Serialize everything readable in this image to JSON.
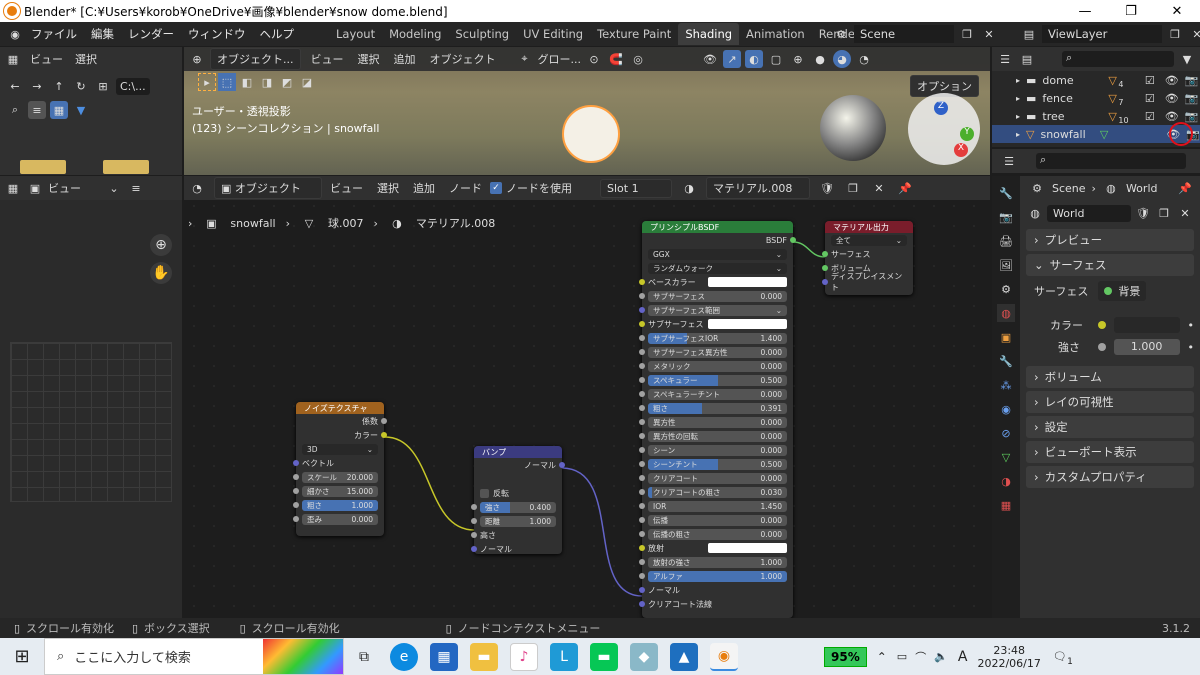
{
  "window": {
    "title": "Blender* [C:¥Users¥korob¥OneDrive¥画像¥blender¥snow dome.blend]"
  },
  "menu": [
    "ファイル",
    "編集",
    "レンダー",
    "ウィンドウ",
    "ヘルプ"
  ],
  "workspaces": [
    "Layout",
    "Modeling",
    "Sculpting",
    "UV Editing",
    "Texture Paint",
    "Shading",
    "Animation",
    "Rendering"
  ],
  "scene": {
    "name": "Scene",
    "view_layer": "ViewLayer"
  },
  "filebrowser": {
    "menu_view": "ビュー",
    "menu_select": "選択",
    "path": "C:\\..."
  },
  "viewport": {
    "mode": "オブジェクト...",
    "menu": [
      "ビュー",
      "選択",
      "追加",
      "オブジェクト"
    ],
    "transform": "グロー...",
    "options": "オプション",
    "title": "ユーザー・透視投影",
    "subtitle": "(123) シーンコレクション | snowfall"
  },
  "node_editor": {
    "header_view": "ビュー",
    "mode": "オブジェクト",
    "menu": [
      "ビュー",
      "選択",
      "追加",
      "ノード"
    ],
    "use_nodes": "ノードを使用",
    "slot": "Slot 1",
    "material": "マテリアル.008",
    "breadcrumb": [
      "snowfall",
      "球.007",
      "マテリアル.008"
    ]
  },
  "left_header": {
    "view": "ビュー"
  },
  "noise": {
    "title": "ノイズテクスチャ",
    "out_fac": "係数",
    "out_color": "カラー",
    "dim": "3D",
    "in_vector": "ベクトル",
    "fields": [
      {
        "label": "スケール",
        "value": "20.000",
        "fill": 0
      },
      {
        "label": "細かさ",
        "value": "15.000",
        "fill": 0
      },
      {
        "label": "粗さ",
        "value": "1.000",
        "fill": 1
      },
      {
        "label": "歪み",
        "value": "0.000",
        "fill": 0
      }
    ]
  },
  "bump": {
    "title": "バンプ",
    "out_normal": "ノーマル",
    "invert": "反転",
    "fields": [
      {
        "label": "強さ",
        "value": "0.400",
        "fill": 0.4
      },
      {
        "label": "距離",
        "value": "1.000",
        "fill": 0
      }
    ],
    "in_height": "高さ",
    "in_normal": "ノーマル"
  },
  "principled": {
    "title": "プリンシプルBSDF",
    "out": "BSDF",
    "dist": "GGX",
    "sss_method": "ランダムウォーク",
    "base_color": "ベースカラー",
    "rows": [
      {
        "label": "サブサーフェス",
        "value": "0.000",
        "fill": 0
      },
      {
        "label": "サブサーフェス範囲",
        "value": "",
        "fill": 0,
        "type": "dd"
      },
      {
        "label": "サブサーフェス...",
        "value": "",
        "fill": 0,
        "type": "color"
      },
      {
        "label": "サブサーフェスIOR",
        "value": "1.400",
        "fill": 0.28
      },
      {
        "label": "サブサーフェス異方性",
        "value": "0.000",
        "fill": 0
      },
      {
        "label": "メタリック",
        "value": "0.000",
        "fill": 0
      },
      {
        "label": "スペキュラー",
        "value": "0.500",
        "fill": 0.5
      },
      {
        "label": "スペキュラーチント",
        "value": "0.000",
        "fill": 0
      },
      {
        "label": "粗さ",
        "value": "0.391",
        "fill": 0.391
      },
      {
        "label": "異方性",
        "value": "0.000",
        "fill": 0
      },
      {
        "label": "異方性の回転",
        "value": "0.000",
        "fill": 0
      },
      {
        "label": "シーン",
        "value": "0.000",
        "fill": 0
      },
      {
        "label": "シーンチント",
        "value": "0.500",
        "fill": 0.5
      },
      {
        "label": "クリアコート",
        "value": "0.000",
        "fill": 0
      },
      {
        "label": "クリアコートの粗さ",
        "value": "0.030",
        "fill": 0.03
      },
      {
        "label": "IOR",
        "value": "1.450",
        "fill": 0
      },
      {
        "label": "伝播",
        "value": "0.000",
        "fill": 0
      },
      {
        "label": "伝播の粗さ",
        "value": "0.000",
        "fill": 0
      },
      {
        "label": "放射",
        "value": "",
        "fill": 0,
        "type": "color"
      },
      {
        "label": "放射の強さ",
        "value": "1.000",
        "fill": 0
      },
      {
        "label": "アルファ",
        "value": "1.000",
        "fill": 1
      },
      {
        "label": "ノーマル",
        "value": "",
        "fill": 0,
        "type": "socket"
      },
      {
        "label": "クリアコート法線",
        "value": "",
        "fill": 0,
        "type": "socket"
      }
    ]
  },
  "output": {
    "title": "マテリアル出力",
    "target": "全て",
    "inputs": [
      "サーフェス",
      "ボリューム",
      "ディスプレイスメント"
    ]
  },
  "outliner": {
    "items": [
      {
        "name": "dome",
        "badge": "4"
      },
      {
        "name": "fence",
        "badge": "7"
      },
      {
        "name": "tree",
        "badge": "10"
      },
      {
        "name": "snowfall",
        "badge": ""
      }
    ]
  },
  "properties": {
    "breadcrumb_scene": "Scene",
    "breadcrumb_world": "World",
    "world": "World",
    "panels_top": [
      "プレビュー",
      "サーフェス"
    ],
    "surface_label": "サーフェス",
    "surface_value": "背景",
    "color_label": "カラー",
    "strength_label": "強さ",
    "strength_value": "1.000",
    "panels_bottom": [
      "ボリューム",
      "レイの可視性",
      "設定",
      "ビューポート表示",
      "カスタムプロパティ"
    ]
  },
  "statusbar": {
    "items": [
      "スクロール有効化",
      "ボックス選択",
      "スクロール有効化",
      "ノードコンテクストメニュー"
    ],
    "version": "3.1.2"
  },
  "taskbar": {
    "search": "ここに入力して検索",
    "battery": "95%",
    "ime": "A",
    "time": "23:48",
    "date": "2022/06/17",
    "notif": "1"
  },
  "colors": {
    "accent": "#4772b3",
    "active_outline": "#334d80",
    "annotation": "#e0101a"
  }
}
